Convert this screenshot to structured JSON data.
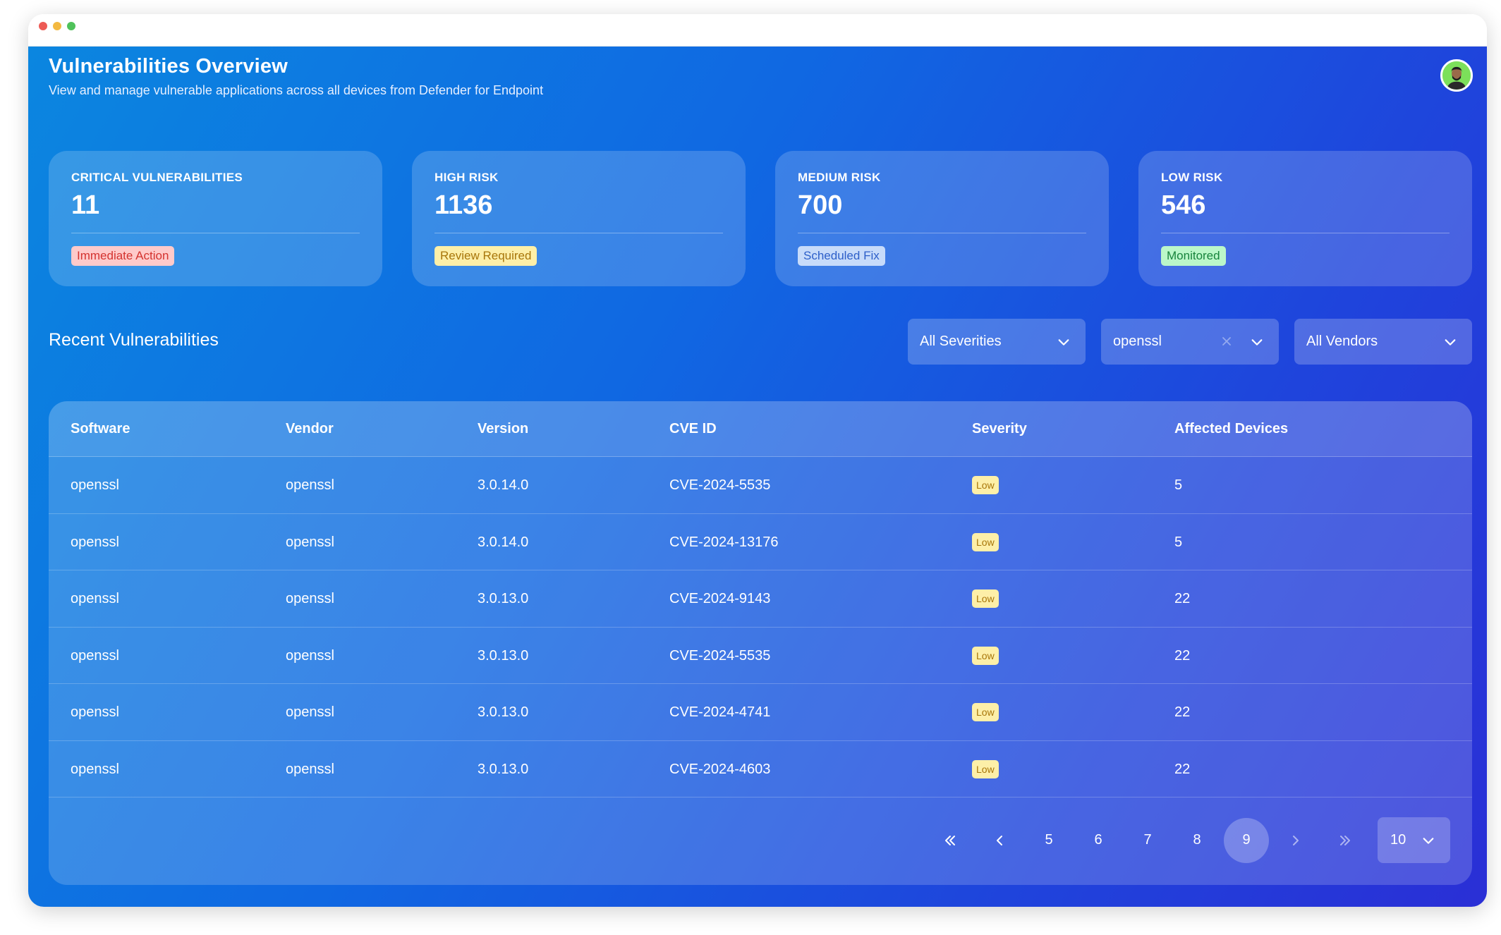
{
  "header": {
    "title": "Vulnerabilities Overview",
    "subtitle": "View and manage vulnerable applications across all devices from Defender for Endpoint"
  },
  "cards": [
    {
      "label": "CRITICAL VULNERABILITIES",
      "value": "11",
      "badge": "Immediate Action",
      "badge_color": "#fecaca"
    },
    {
      "label": "HIGH RISK",
      "value": "1136",
      "badge": "Review Required",
      "badge_color": "#fdefa8"
    },
    {
      "label": "MEDIUM RISK",
      "value": "700",
      "badge": "Scheduled Fix",
      "badge_color": "#c7dbfa"
    },
    {
      "label": "LOW RISK",
      "value": "546",
      "badge": "Monitored",
      "badge_color": "#bbf7c9"
    }
  ],
  "section": {
    "title": "Recent Vulnerabilities"
  },
  "filters": {
    "severity": "All Severities",
    "search": "openssl",
    "vendor": "All Vendors"
  },
  "table": {
    "columns": [
      "Software",
      "Vendor",
      "Version",
      "CVE ID",
      "Severity",
      "Affected Devices"
    ],
    "rows": [
      [
        "openssl",
        "openssl",
        "3.0.14.0",
        "CVE-2024-5535",
        "Low",
        "5"
      ],
      [
        "openssl",
        "openssl",
        "3.0.14.0",
        "CVE-2024-13176",
        "Low",
        "5"
      ],
      [
        "openssl",
        "openssl",
        "3.0.13.0",
        "CVE-2024-9143",
        "Low",
        "22"
      ],
      [
        "openssl",
        "openssl",
        "3.0.13.0",
        "CVE-2024-5535",
        "Low",
        "22"
      ],
      [
        "openssl",
        "openssl",
        "3.0.13.0",
        "CVE-2024-4741",
        "Low",
        "22"
      ],
      [
        "openssl",
        "openssl",
        "3.0.13.0",
        "CVE-2024-4603",
        "Low",
        "22"
      ]
    ]
  },
  "pagination": {
    "pages": [
      "5",
      "6",
      "7",
      "8",
      "9"
    ],
    "current": "9",
    "page_size": "10"
  },
  "icons": {
    "first": "chevrons-left-icon",
    "prev": "chevron-left-icon",
    "next": "chevron-right-icon",
    "last": "chevrons-right-icon",
    "dropdown": "chevron-down-icon",
    "clear": "close-icon"
  }
}
